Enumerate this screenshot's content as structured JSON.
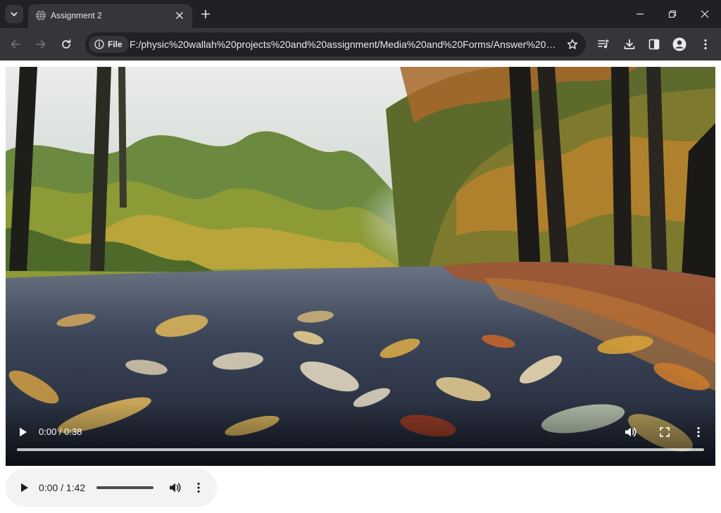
{
  "browser": {
    "tab": {
      "title": "Assignment 2"
    },
    "address_bar": {
      "chip_label": "File",
      "url": "F:/physic%20wallah%20projects%20and%20assignment/Media%20and%20Forms/Answer%202/ind..."
    }
  },
  "page": {
    "video": {
      "time": "0:00 / 0:38",
      "progress": 0
    },
    "audio": {
      "time": "0:00 / 1:42",
      "progress": 0
    }
  },
  "icons": {
    "tab_search": "chevron-down-icon",
    "favicon": "globe-icon",
    "tab_close": "close-icon",
    "new_tab": "plus-icon",
    "minimize": "minimize-icon",
    "restore": "restore-icon",
    "close_window": "close-icon",
    "back": "arrow-left-icon",
    "forward": "arrow-right-icon",
    "reload": "reload-icon",
    "site_info": "info-icon",
    "bookmark": "star-icon",
    "media_control": "media-control-icon",
    "downloads": "download-icon",
    "side_panel": "side-panel-icon",
    "profile": "profile-icon",
    "menu": "kebab-menu-icon",
    "play": "play-icon",
    "volume": "volume-icon",
    "fullscreen": "fullscreen-icon",
    "more": "kebab-menu-icon"
  },
  "colors": {
    "tabstrip": "#202124",
    "toolbar": "#35363a",
    "omnibox": "#202124",
    "audio_bg": "#f1f3f4"
  }
}
